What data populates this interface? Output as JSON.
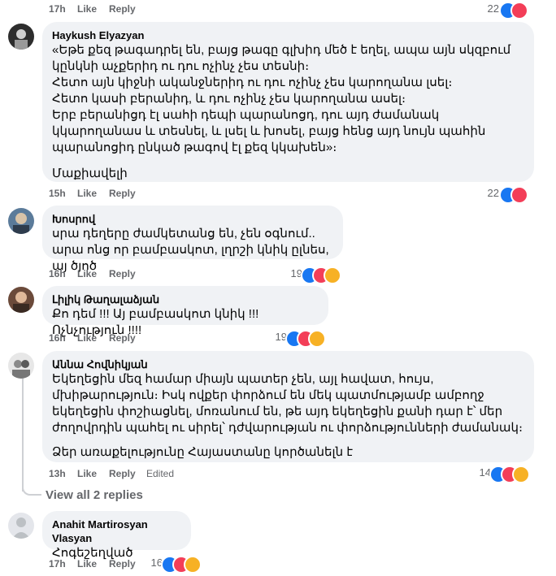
{
  "top_row": {
    "time": "17h",
    "like": "Like",
    "reply": "Reply",
    "count": "22"
  },
  "comments": [
    {
      "name": "Haykush Elyazyan",
      "text": "«Եթե քեզ թագադրել են, բայց թագը գլխիդ մեծ է եղել, ապա այն սկզբում կընկնի աչքերիդ ու դու ոչինչ չես տեսնի։\nՀետո այն կիջնի ականջներիդ ու դու ոչինչ չես կարողանա լսել։\nՀետո կասի բերանիդ, և դու ոչինչ չես կարողանա ասել։\nԵրբ բերանիցդ էլ սահի դեպի պարանոցդ, դու այդ ժամանակ կկարողանաս և տեսնել, և լսել և խոսել, բայց հենց այդ նույն պահին պարանոցիդ ընկած թագով էլ քեզ կկախեն»։",
      "text2": "Մաքիավելի",
      "time": "15h",
      "like": "Like",
      "reply": "Reply",
      "count": "22"
    },
    {
      "name": "Խոսրով",
      "text": "սրա դեղերը ժամկետանց են, չեն օգնում..\nարա ոնց որ բամբասկոտ, լղրշի կնիկ ըլնես, այ ծյոծ",
      "time": "16h",
      "like": "Like",
      "reply": "Reply",
      "count": "19"
    },
    {
      "name": "Լիլիկ Թաղալաձյան",
      "text": "Քո դեմ !!! Այ բամբասկոտ կնիկ !!! Ոչնչություն !!!!",
      "time": "16h",
      "like": "Like",
      "reply": "Reply",
      "count": "19"
    },
    {
      "name": "Աննա Հովնիկյան",
      "text": "Եկեղեցին մեզ համար միայն պատեր չեն, այլ հավատ, հույս, մխիթարություն։ Իսկ ովքեր փորձում են մեկ պատմությամբ ամբողջ եկեղեցին փոշիացնել, մոռանում են, թե այդ եկեղեցին քանի դար է՝ մեր ժողովրդին պահել ու սիրել՝ դժվարության ու փորձությունների ժամանակ։",
      "text2": "Ձեր առաքելությունը Հայաստանը կործանելն է",
      "time": "13h",
      "like": "Like",
      "reply": "Reply",
      "edited": "Edited",
      "count": "14"
    },
    {
      "name": "Anahit Martirosyan Vlasyan",
      "text": "Հոգեշեղված",
      "time": "17h",
      "like": "Like",
      "reply": "Reply",
      "count": "16"
    }
  ],
  "view_replies": "View all 2 replies",
  "colors": {
    "like": "#1877f2",
    "love": "#f33e58",
    "angry": "#f7b125",
    "bubble": "#f0f2f5",
    "meta": "#65676b"
  }
}
